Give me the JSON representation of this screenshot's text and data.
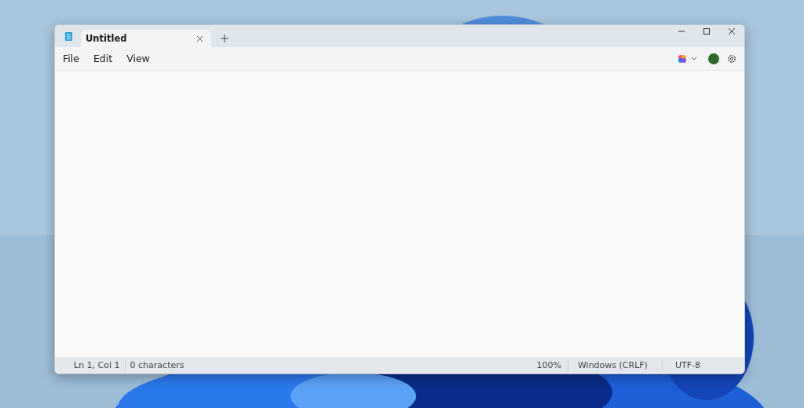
{
  "tabs": [
    {
      "label": "Untitled",
      "selected": true
    }
  ],
  "menu": [
    "File",
    "Edit",
    "View"
  ],
  "status_bar": {
    "position": "Ln 1, Col 1",
    "characters": "0 characters",
    "zoom": "100%",
    "line_ending": "Windows (CRLF)",
    "encoding": "UTF-8"
  }
}
